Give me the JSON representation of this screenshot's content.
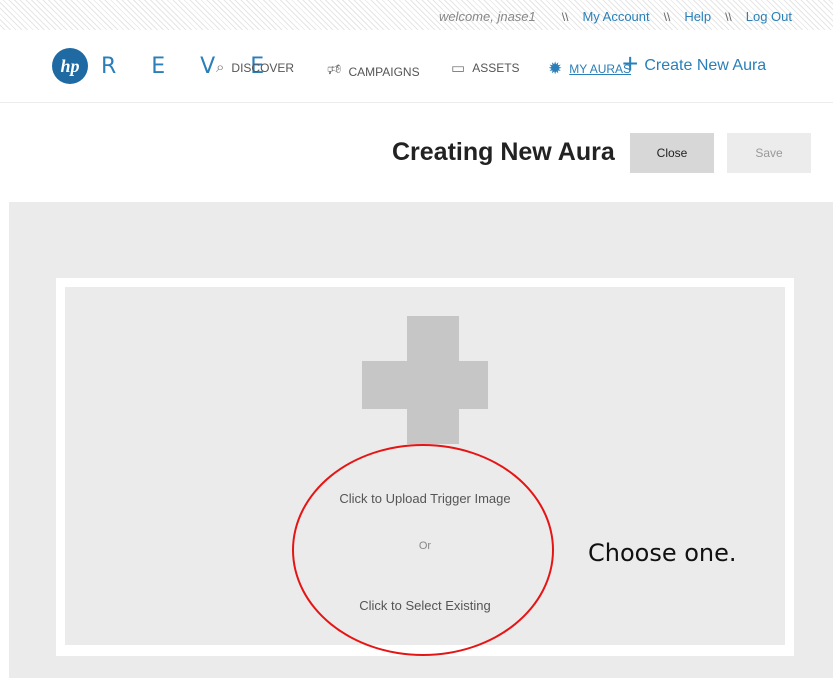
{
  "topbar": {
    "welcome": "welcome, jnase1",
    "separator": "\\\\",
    "my_account": "My Account",
    "help": "Help",
    "logout": "Log Out"
  },
  "nav": {
    "logo": "hp",
    "brand": "R E V E",
    "discover": "DISCOVER",
    "campaigns": "CAMPAIGNS",
    "assets": "ASSETS",
    "my_auras": "MY AURAS",
    "create": "Create New Aura"
  },
  "page": {
    "title": "Creating New Aura",
    "close_label": "Close",
    "save_label": "Save"
  },
  "upload": {
    "upload_text": "Click to Upload Trigger Image",
    "or_text": "Or",
    "select_text": "Click to Select Existing"
  },
  "annotation": {
    "note": "Choose one."
  },
  "colors": {
    "accent": "#2a7fb8",
    "annotation": "#e51515"
  }
}
